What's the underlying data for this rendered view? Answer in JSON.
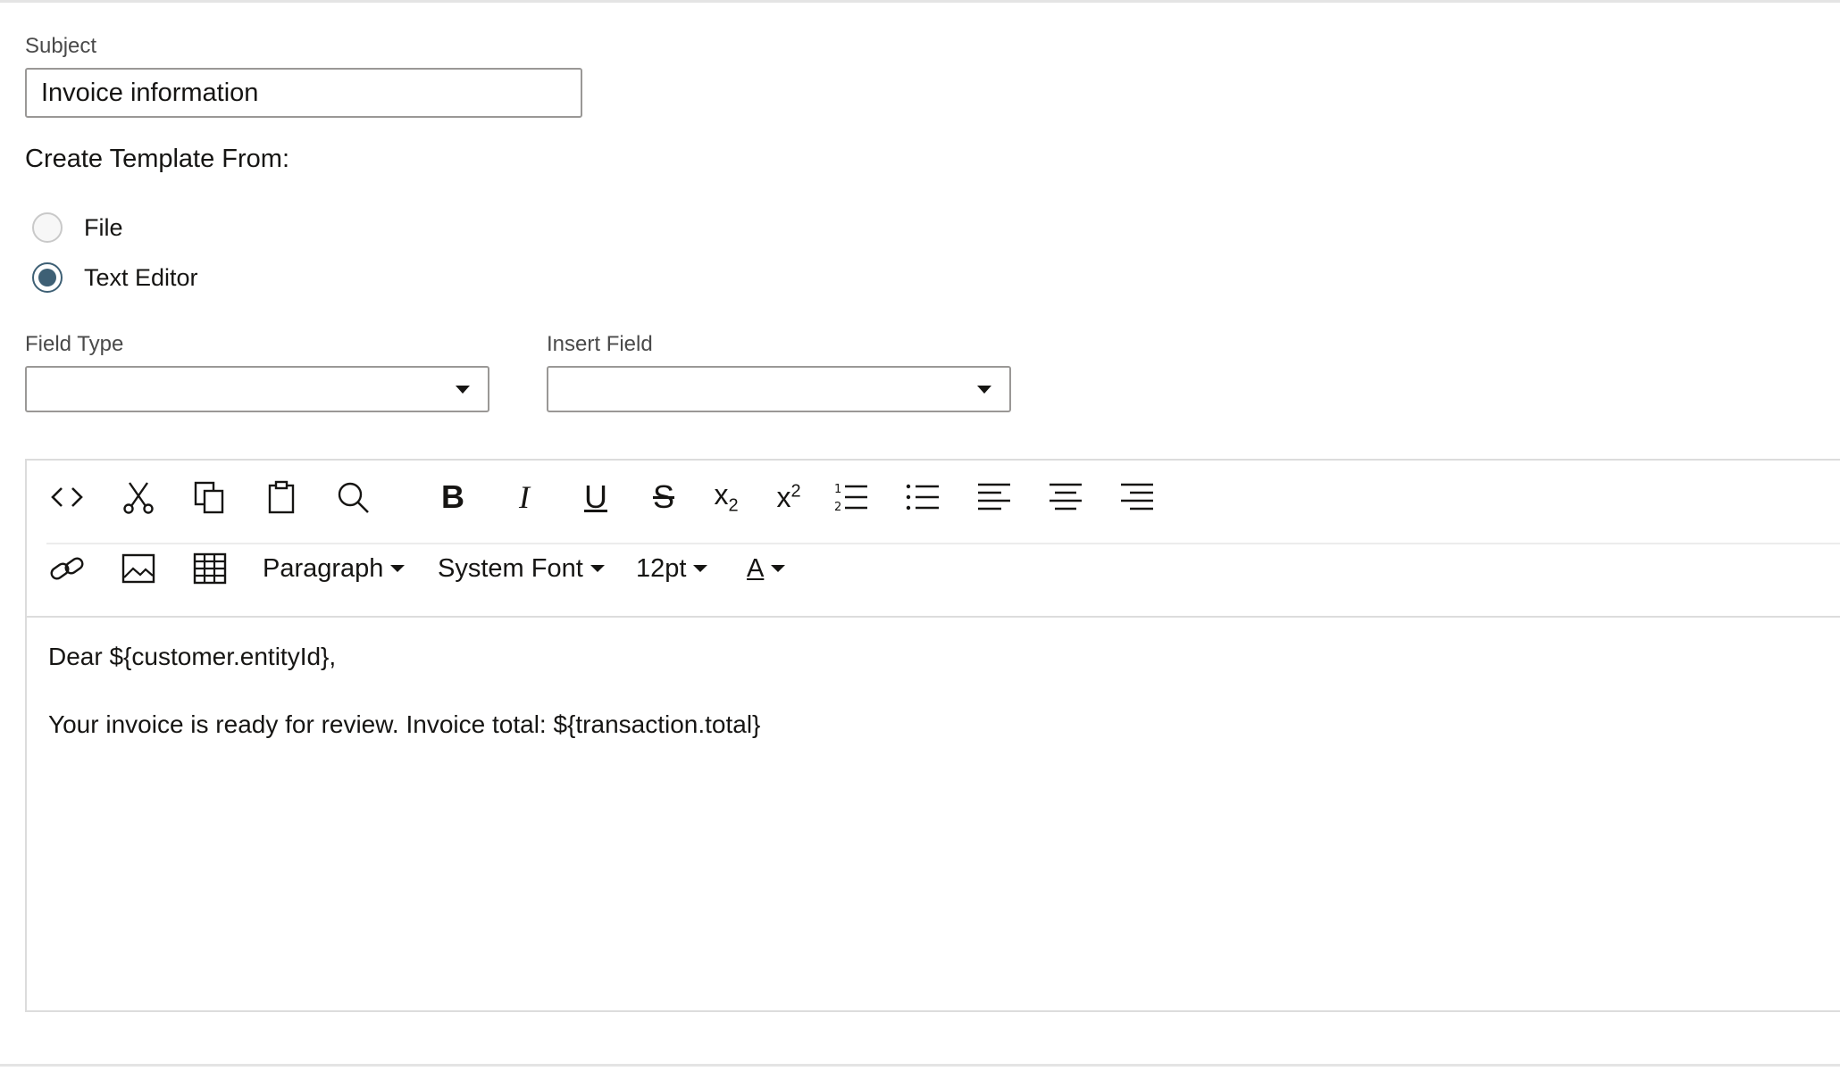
{
  "form": {
    "subject_label": "Subject",
    "subject_value": "Invoice information",
    "create_from_label": "Create Template From:",
    "radios": [
      {
        "label": "File",
        "checked": false
      },
      {
        "label": "Text Editor",
        "checked": true
      }
    ],
    "field_type_label": "Field Type",
    "field_type_value": "",
    "insert_field_label": "Insert Field",
    "insert_field_value": ""
  },
  "toolbar": {
    "row1_icons": [
      "source-code-icon",
      "cut-icon",
      "copy-icon",
      "paste-icon",
      "find-icon",
      "bold-icon",
      "italic-icon",
      "underline-icon",
      "strikethrough-icon",
      "subscript-icon",
      "superscript-icon",
      "numbered-list-icon",
      "bulleted-list-icon",
      "align-left-icon",
      "align-center-icon",
      "align-right-icon"
    ],
    "row2_icons": [
      "link-icon",
      "image-icon",
      "table-icon"
    ],
    "bold": "B",
    "italic": "I",
    "underline": "U",
    "strikethrough": "S",
    "subscript_base": "x",
    "subscript_sub": "2",
    "superscript_base": "x",
    "superscript_sup": "2",
    "block_format": "Paragraph",
    "font_family": "System Font",
    "font_size": "12pt",
    "text_color_letter": "A"
  },
  "editor": {
    "lines": [
      "Dear ${customer.entityId},",
      "Your invoice is ready for review. Invoice total: ${transaction.total}"
    ]
  },
  "colors": {
    "radio_checked": "#3e6075",
    "border": "#9a9896",
    "text": "#161513"
  }
}
